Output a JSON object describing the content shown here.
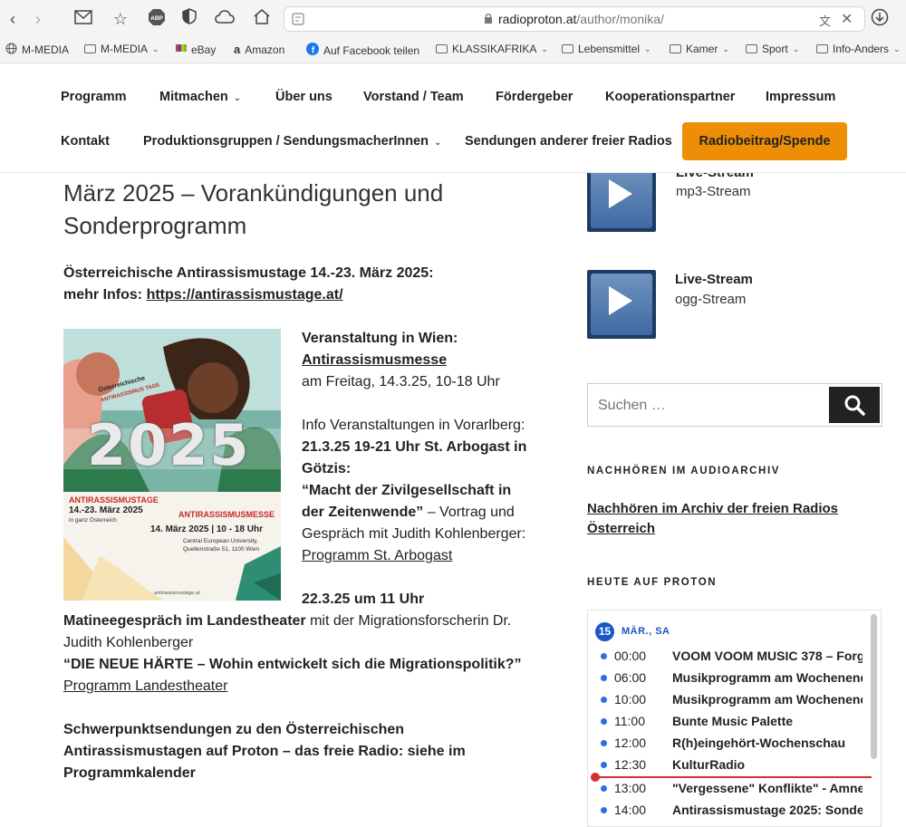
{
  "browser": {
    "url_host": "radioproton.at",
    "url_path": "/author/monika/",
    "bookmarks": [
      {
        "label": "M-MEDIA",
        "icon": "globe-icon"
      },
      {
        "label": "M-MEDIA",
        "icon": "folder-icon"
      },
      {
        "label": "eBay",
        "icon": "ebay-icon"
      },
      {
        "label": "Amazon",
        "icon": "amazon-icon"
      },
      {
        "label": "Auf Facebook teilen",
        "icon": "facebook-icon"
      },
      {
        "label": "KLASSIKAFRIKA",
        "icon": "folder-icon"
      },
      {
        "label": "Lebensmittel",
        "icon": "folder-icon"
      },
      {
        "label": "Kamer",
        "icon": "folder-icon"
      },
      {
        "label": "Sport",
        "icon": "folder-icon"
      },
      {
        "label": "Info-Anders",
        "icon": "folder-icon"
      }
    ]
  },
  "nav": {
    "row1": [
      "Programm",
      "Mitmachen",
      "Über uns",
      "Vorstand / Team",
      "Fördergeber",
      "Kooperationspartner",
      "Impressum"
    ],
    "row2": [
      "Kontakt",
      "Produktionsgruppen / SendungsmacherInnen",
      "Sendungen anderer freier Radios"
    ],
    "cta": "Radiobeitrag/Spende"
  },
  "post": {
    "title_line1": "März 2025 – Vorankündigungen und",
    "title_line2": "Sonderprogramm",
    "intro_bold": "Österreichische Antirassismustage 14.-23. März 2025:",
    "more_info_label": "mehr Infos: ",
    "more_info_link": "https://antirassismustage.at/",
    "wien_heading": "Veranstaltung in Wien:",
    "wien_link": "Antirassismusmesse",
    "wien_date": "am Freitag, 14.3.25, 10-18 Uhr",
    "vbg_intro": "Info Veranstaltungen in Vorarlberg:",
    "vbg_event1_line1": "21.3.25 19-21 Uhr St. Arbogast in",
    "vbg_event1_line2": "Götzis:",
    "vbg_quote1_line1": "“Macht der Zivilgesellschaft in",
    "vbg_quote1_line2_bold": "der Zeitenwende”",
    "vbg_quote1_line2_rest": " – Vortrag und",
    "vbg_quote1_line3": "Gespräch mit Judith Kohlenberger:",
    "vbg_link1": "Programm St. Arbogast",
    "event2_date": "22.3.25 um 11 Uhr",
    "event2_bold": "Matineegespräch im Landestheater",
    "event2_rest": " mit der Migrationsforscherin Dr.",
    "event2_line3": "Judith Kohlenberger",
    "event2_quote": "“DIE NEUE HÄRTE – Wohin entwickelt sich die Migrationspolitik?”",
    "event2_link": "Programm Landestheater",
    "closing_line1": "Schwerpunktsendungen zu den Österreichischen",
    "closing_line2": "Antirassismustagen auf Proton – das freie Radio: siehe im",
    "closing_line3": "Programmkalender"
  },
  "poster": {
    "subtitle": "Österreichische",
    "tag": "ANTIRASSISMUS TAGE",
    "year": "2025",
    "left_title": "ANTIRASSISMUSTAGE",
    "left_dates": "14.-23. März 2025",
    "left_place": "in ganz Österreich",
    "right_title": "ANTIRASSISMUSMESSE",
    "right_date": "14. März 2025 | 10 - 18 Uhr",
    "right_place1": "Central European University,",
    "right_place2": "Quellenstraße 51, 1100 Wien",
    "footer": "antirassismustage.at"
  },
  "sidebar": {
    "stream1_title": "Live-Stream",
    "stream1_sub": "mp3-Stream",
    "stream2_title": "Live-Stream",
    "stream2_sub": "ogg-Stream",
    "search_placeholder": "Suchen …",
    "archive_heading": "NACHHÖREN IM AUDIOARCHIV",
    "archive_link": "Nachhören im Archiv der freien Radios Österreich",
    "today_heading": "HEUTE AUF PROTON",
    "day_number": "15",
    "day_label": "MÄR., SA",
    "schedule": [
      {
        "time": "00:00",
        "title": "VOOM VOOM MUSIC 378 – Forg"
      },
      {
        "time": "06:00",
        "title": "Musikprogramm am Wochenend"
      },
      {
        "time": "10:00",
        "title": "Musikprogramm am Wochenend"
      },
      {
        "time": "11:00",
        "title": "Bunte Music Palette"
      },
      {
        "time": "12:00",
        "title": "R(h)eingehört-Wochenschau"
      },
      {
        "time": "12:30",
        "title": "KulturRadio"
      },
      {
        "time": "13:00",
        "title": "\"Vergessene\" Konflikte\" - Amne"
      },
      {
        "time": "14:00",
        "title": "Antirassismustage 2025: Sonder"
      }
    ]
  }
}
